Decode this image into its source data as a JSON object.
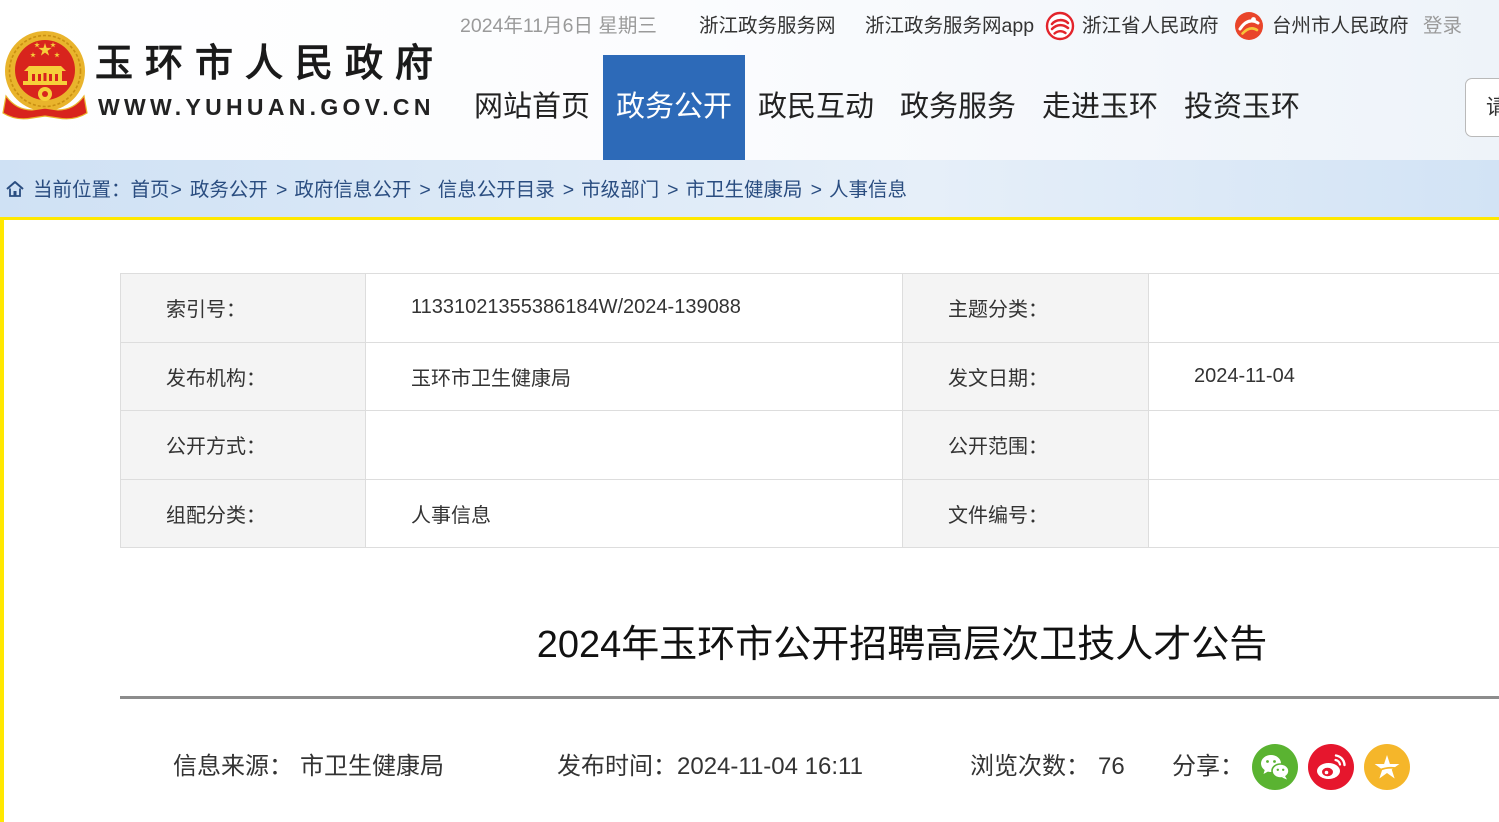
{
  "header": {
    "site_name": "玉环市人民政府",
    "site_url": "WWW.YUHUAN.GOV.CN",
    "logo_icon": "national-emblem-icon",
    "date": "2024年11月6日 星期三",
    "top_links": [
      {
        "label": "浙江政务服务网"
      },
      {
        "label": "浙江政务服务网app"
      },
      {
        "label": "浙江省人民政府",
        "icon": "zhejiang-gov-icon"
      },
      {
        "label": "台州市人民政府",
        "icon": "taizhou-gov-icon"
      }
    ],
    "login_label": "登录",
    "nav": [
      {
        "label": "网站首页",
        "active": false
      },
      {
        "label": "政务公开",
        "active": true
      },
      {
        "label": "政民互动",
        "active": false
      },
      {
        "label": "政务服务",
        "active": false
      },
      {
        "label": "走进玉环",
        "active": false
      },
      {
        "label": "投资玉环",
        "active": false
      }
    ],
    "search": {
      "placeholder": "请"
    }
  },
  "breadcrumb": {
    "icon": "home-icon",
    "prefix": "当前位置：",
    "separator": ">",
    "items": [
      "首页",
      "政务公开",
      "政府信息公开",
      "信息公开目录",
      "市级部门",
      "市卫生健康局",
      "人事信息"
    ]
  },
  "info_table": {
    "rows": [
      [
        {
          "label": "索引号：",
          "value": "11331021355386184W/2024-139088"
        },
        {
          "label": "主题分类："
        }
      ],
      [
        {
          "label": "发布机构：",
          "value": "玉环市卫生健康局"
        },
        {
          "label": "发文日期：",
          "value": "2024-11-04"
        }
      ],
      [
        {
          "label": "公开方式："
        },
        {
          "label": "公开范围："
        }
      ],
      [
        {
          "label": "组配分类：",
          "value": "人事信息"
        },
        {
          "label": "文件编号："
        }
      ]
    ]
  },
  "article": {
    "title": "2024年玉环市公开招聘高层次卫技人才公告",
    "meta": {
      "source_label": "信息来源：",
      "source": "市卫生健康局",
      "time_label": "发布时间：",
      "time": "2024-11-04 16:11",
      "views_label": "浏览次数：",
      "views": "76",
      "share_label": "分享："
    },
    "share_icons": [
      "wechat-icon",
      "weibo-icon",
      "qzone-icon"
    ]
  },
  "colors": {
    "nav_active_bg": "#2d6ab8",
    "breadcrumb_text": "#2a4d80",
    "focus_outline": "#ffe800",
    "wechat": "#5ab331",
    "weibo": "#e6162d",
    "qzone": "#f5b62a"
  }
}
